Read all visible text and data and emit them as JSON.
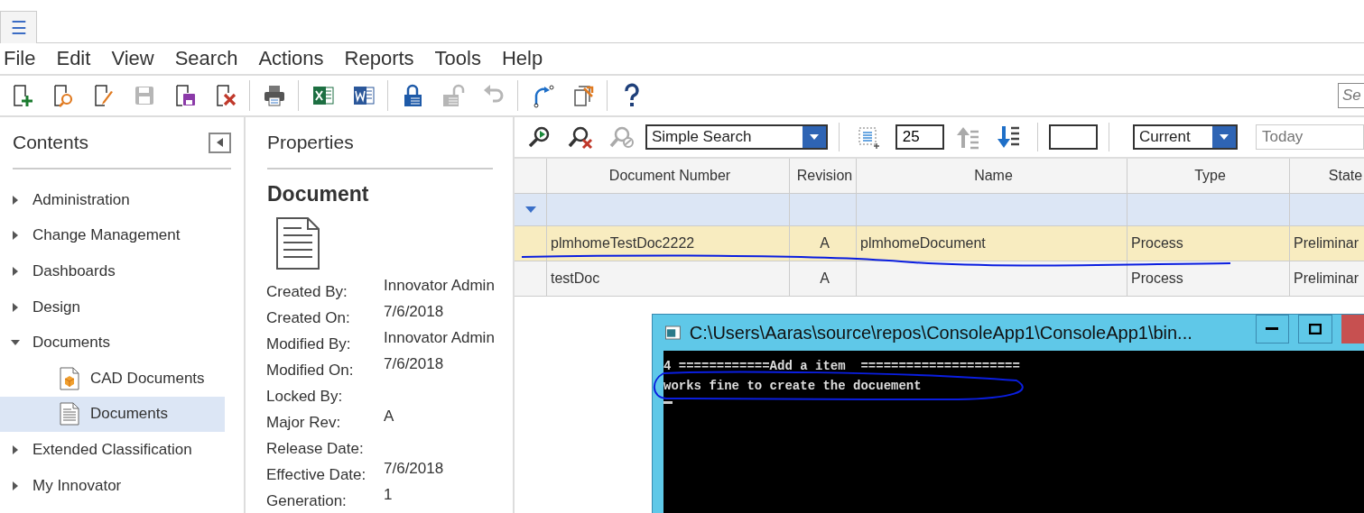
{
  "app_tab": {
    "label": "☰",
    "selected": true
  },
  "menu": [
    "File",
    "Edit",
    "View",
    "Search",
    "Actions",
    "Reports",
    "Tools",
    "Help"
  ],
  "toolbar": [
    {
      "kind": "new",
      "disabled": false
    },
    {
      "kind": "open",
      "disabled": false
    },
    {
      "kind": "edit",
      "disabled": false
    },
    {
      "kind": "save",
      "disabled": true
    },
    {
      "kind": "save-close",
      "disabled": false
    },
    {
      "kind": "discard",
      "disabled": false
    },
    {
      "kind": "separator"
    },
    {
      "kind": "print",
      "disabled": false
    },
    {
      "kind": "separator"
    },
    {
      "kind": "excel",
      "disabled": false
    },
    {
      "kind": "word",
      "disabled": false
    },
    {
      "kind": "separator"
    },
    {
      "kind": "lock",
      "disabled": false
    },
    {
      "kind": "unlock",
      "disabled": true
    },
    {
      "kind": "undo",
      "disabled": true
    },
    {
      "kind": "separator"
    },
    {
      "kind": "promote",
      "disabled": false
    },
    {
      "kind": "version",
      "disabled": false
    },
    {
      "kind": "separator"
    },
    {
      "kind": "help",
      "disabled": false
    }
  ],
  "top_search": {
    "placeholder": "Se"
  },
  "contents": {
    "title": "Contents",
    "items": [
      {
        "label": "Administration",
        "expanded": false,
        "selected": false
      },
      {
        "label": "Change Management",
        "expanded": false,
        "selected": false
      },
      {
        "label": "Dashboards",
        "expanded": false,
        "selected": false
      },
      {
        "label": "Design",
        "expanded": false,
        "selected": false
      },
      {
        "label": "Documents",
        "expanded": true,
        "selected": false,
        "children": [
          {
            "label": "CAD Documents",
            "kind": "cad",
            "selected": false
          },
          {
            "label": "Documents",
            "kind": "doc",
            "selected": true
          }
        ]
      },
      {
        "label": "Extended Classification",
        "expanded": false,
        "selected": false
      },
      {
        "label": "My Innovator",
        "expanded": false,
        "selected": false
      }
    ]
  },
  "properties": {
    "title": "Properties",
    "item_type": "Document",
    "fields": [
      {
        "label": "Created By:",
        "value": "Innovator Admin"
      },
      {
        "label": "Created On:",
        "value": "7/6/2018"
      },
      {
        "label": "Modified By:",
        "value": "Innovator Admin"
      },
      {
        "label": "Modified On:",
        "value": "7/6/2018"
      },
      {
        "label": "Locked By:"
      },
      {
        "label": "Major Rev:",
        "value": "A"
      },
      {
        "label": "Release Date:"
      },
      {
        "label": "Effective Date:",
        "value": "7/6/2018"
      },
      {
        "label": "Generation:",
        "value": "1"
      }
    ]
  },
  "search_bar": {
    "mode": "Simple Search",
    "page_size": "25",
    "revision": "Current",
    "date": {
      "placeholder": "Today"
    }
  },
  "table": {
    "columns": [
      "Document Number",
      "Revision",
      "Name",
      "Type",
      "State"
    ],
    "rows": [
      {
        "cells": [
          "plmhomeTestDoc2222",
          "A",
          "plmhomeDocument",
          "Process",
          "Preliminar"
        ],
        "selected": true,
        "underlined": true
      },
      {
        "cells": [
          "testDoc",
          "A",
          "",
          "Process",
          "Preliminar"
        ],
        "selected": false,
        "underlined": false
      }
    ]
  },
  "console": {
    "title": "C:\\Users\\Aaras\\source\\repos\\ConsoleApp1\\ConsoleApp1\\bin...",
    "lines": [
      {
        "text": "4 ============Add a item  =====================",
        "circled": false
      },
      {
        "text": "works fine to create the docuement",
        "circled": true
      }
    ]
  }
}
